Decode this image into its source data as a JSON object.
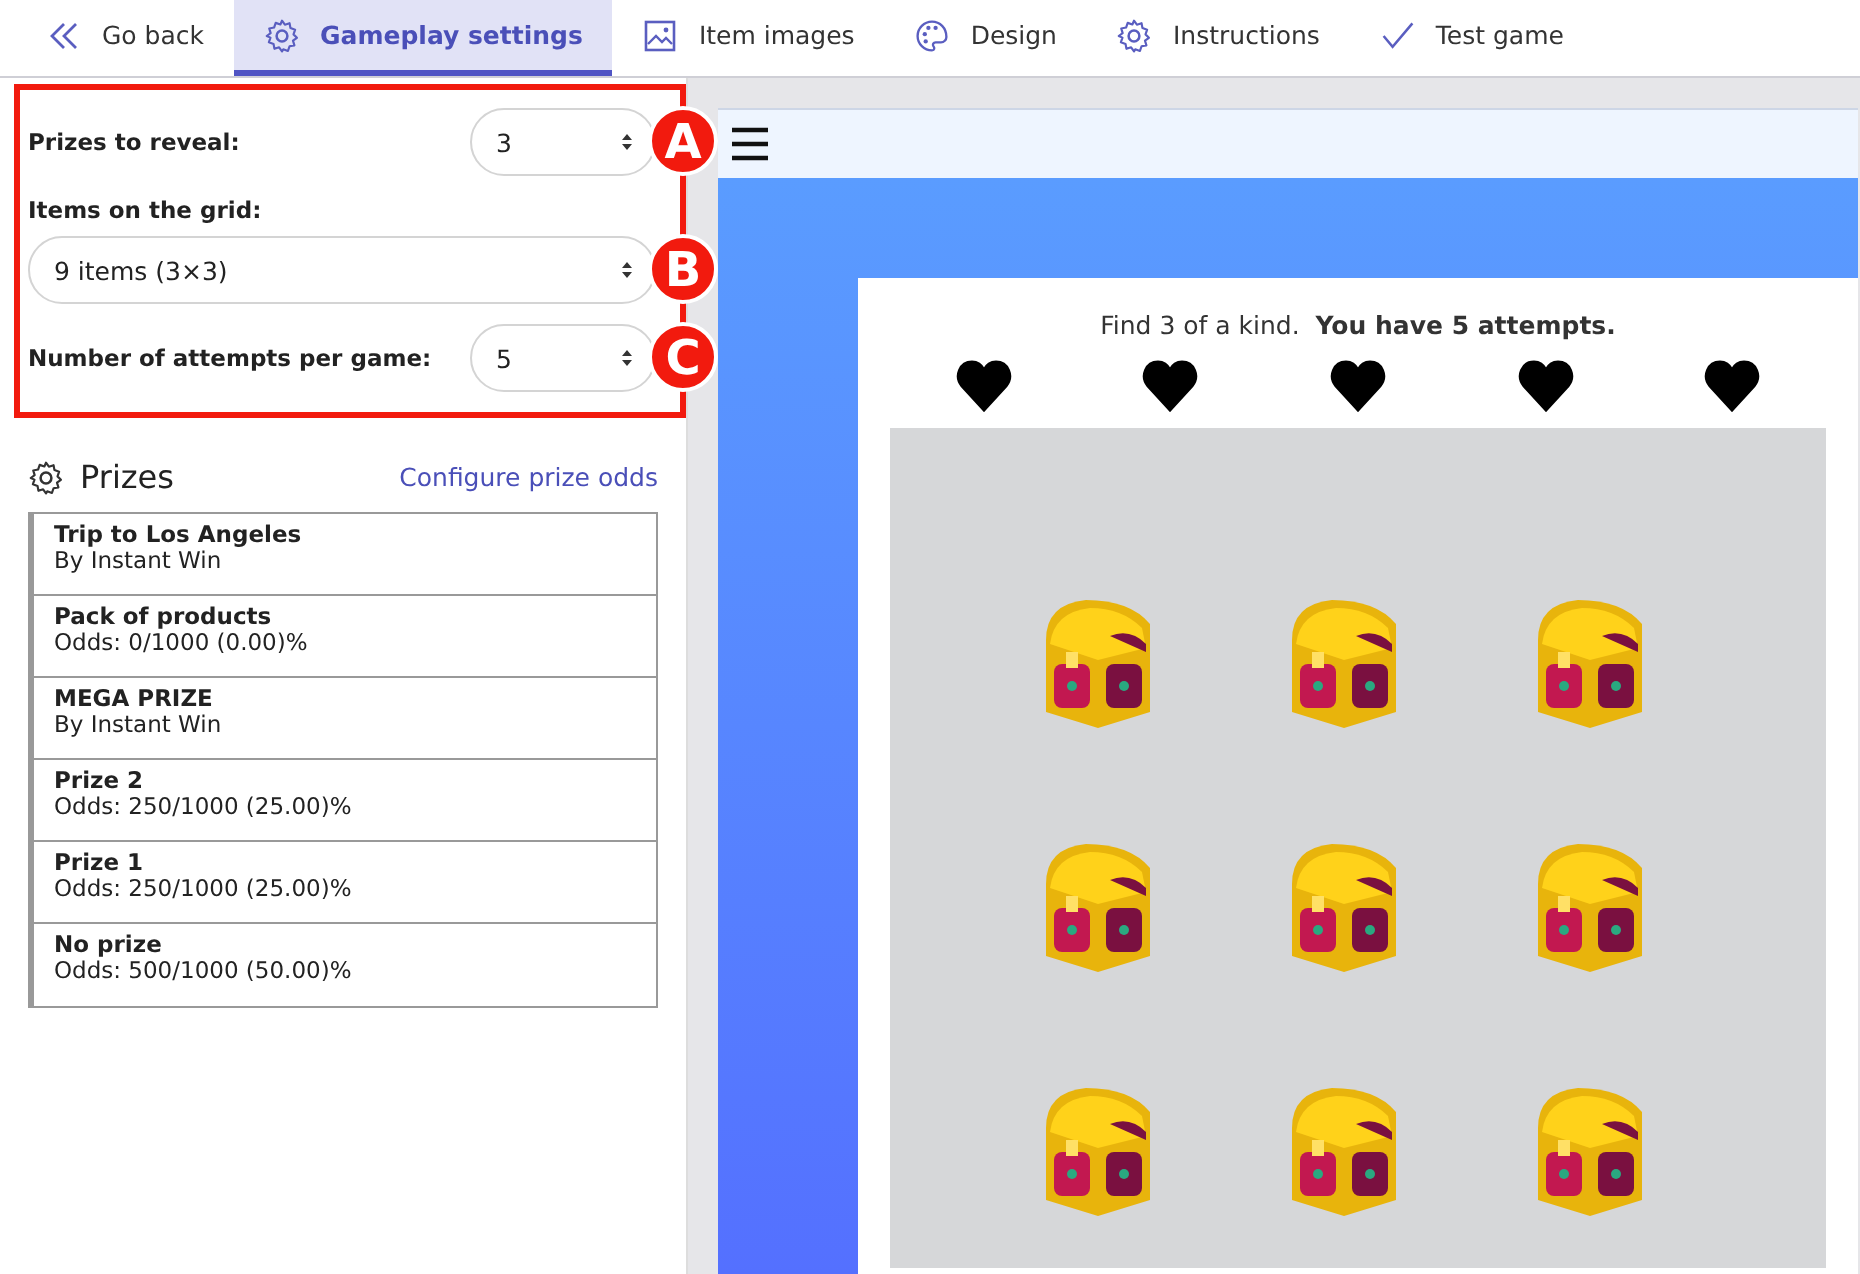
{
  "tabs": [
    {
      "label": "Go back",
      "kind": "back",
      "selected": false
    },
    {
      "label": "Gameplay settings",
      "kind": "gear",
      "selected": true
    },
    {
      "label": "Item images",
      "kind": "image",
      "selected": false
    },
    {
      "label": "Design",
      "kind": "palette",
      "selected": false
    },
    {
      "label": "Instructions",
      "kind": "gear",
      "selected": false
    },
    {
      "label": "Test game",
      "kind": "check",
      "selected": false
    }
  ],
  "settings": [
    {
      "kind": "inline",
      "label": "Prizes to reveal:",
      "value": "3",
      "callout": "A"
    },
    {
      "kind": "stacked",
      "label": "Items on the grid:",
      "value": "9 items (3×3)",
      "callout": "B"
    },
    {
      "kind": "inline",
      "label": "Number of attempts per game:",
      "value": "5",
      "callout": "C"
    }
  ],
  "prizes": {
    "title": "Prizes",
    "link": "Configure prize odds",
    "items": [
      {
        "name": "Trip to Los Angeles",
        "detail": "By Instant Win"
      },
      {
        "name": "Pack of products",
        "detail": "Odds: 0/1000 (0.00)%"
      },
      {
        "name": "MEGA PRIZE",
        "detail": "By Instant Win"
      },
      {
        "name": "Prize 2",
        "detail": "Odds: 250/1000 (25.00)%"
      },
      {
        "name": "Prize 1",
        "detail": "Odds: 250/1000 (25.00)%"
      },
      {
        "name": "No prize",
        "detail": "Odds: 500/1000 (50.00)%"
      }
    ]
  },
  "preview": {
    "instruction": "Find 3 of a kind.  **You have 5 attempts.**",
    "hearts": [
      {
        "filled": true
      },
      {
        "filled": true
      },
      {
        "filled": true
      },
      {
        "filled": true
      },
      {
        "filled": true
      }
    ]
  }
}
